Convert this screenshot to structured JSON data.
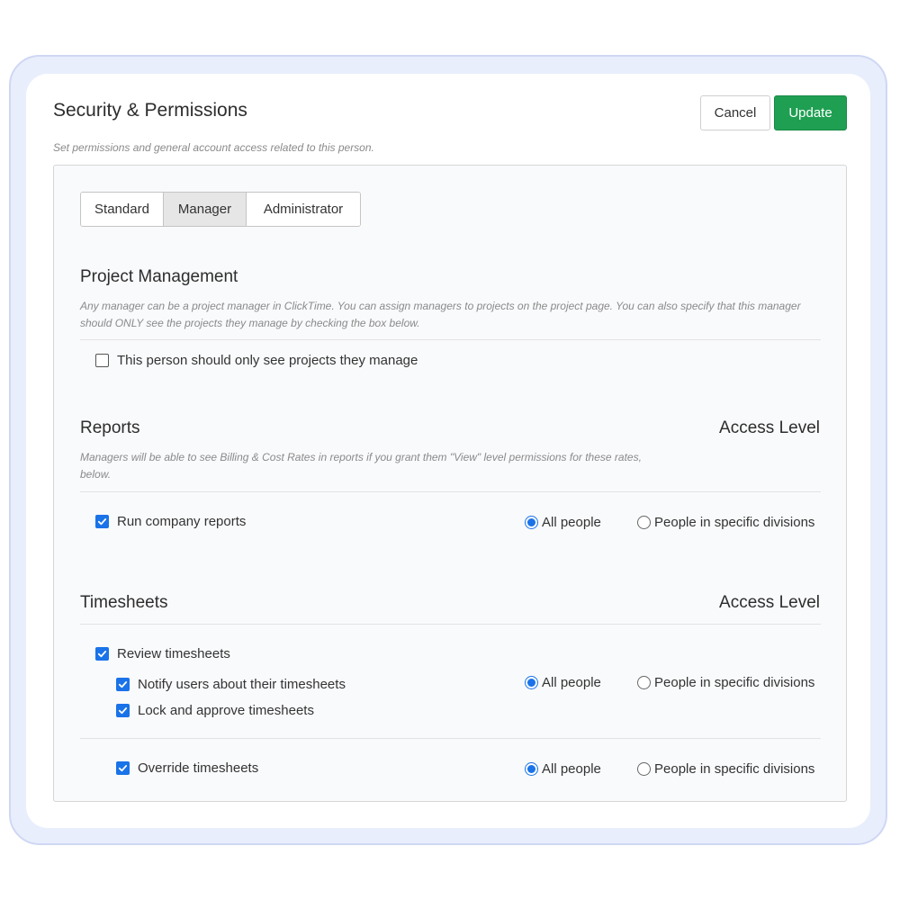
{
  "header": {
    "title": "Security & Permissions",
    "subtitle": "Set permissions and general account access related to this person.",
    "cancel_label": "Cancel",
    "update_label": "Update"
  },
  "role_tabs": [
    {
      "label": "Standard",
      "active": false
    },
    {
      "label": "Manager",
      "active": true
    },
    {
      "label": "Administrator",
      "active": false
    }
  ],
  "project_management": {
    "heading": "Project Management",
    "description_line1": "Any manager can be a project manager in ClickTime. You can assign managers to projects on the project page. You can also specify that this manager",
    "description_line2": "should ONLY see the projects they manage by checking the box below.",
    "checkbox_label": "This person should only see projects they manage",
    "checked": false
  },
  "reports": {
    "heading": "Reports",
    "access_heading": "Access Level",
    "description_line1": "Managers will be able to see Billing & Cost Rates in reports if you grant them \"View\" level permissions for these rates,",
    "description_line2": "below.",
    "run_reports_label": "Run company reports",
    "run_reports_checked": true,
    "access_all_label": "All people",
    "access_divisions_label": "People in specific divisions",
    "access_selected": "All people"
  },
  "timesheets": {
    "heading": "Timesheets",
    "access_heading": "Access Level",
    "review_label": "Review timesheets",
    "review_checked": true,
    "notify_label": "Notify users about their timesheets",
    "notify_checked": true,
    "lock_label": "Lock and approve timesheets",
    "lock_checked": true,
    "override_label": "Override timesheets",
    "override_checked": true,
    "access_all_label": "All people",
    "access_divisions_label": "People in specific divisions",
    "review_access_selected": "All people",
    "override_access_selected": "All people"
  },
  "colors": {
    "accent_blue": "#1a73e8",
    "update_green": "#1f9f52",
    "frame_lavender": "#e9eefc"
  }
}
